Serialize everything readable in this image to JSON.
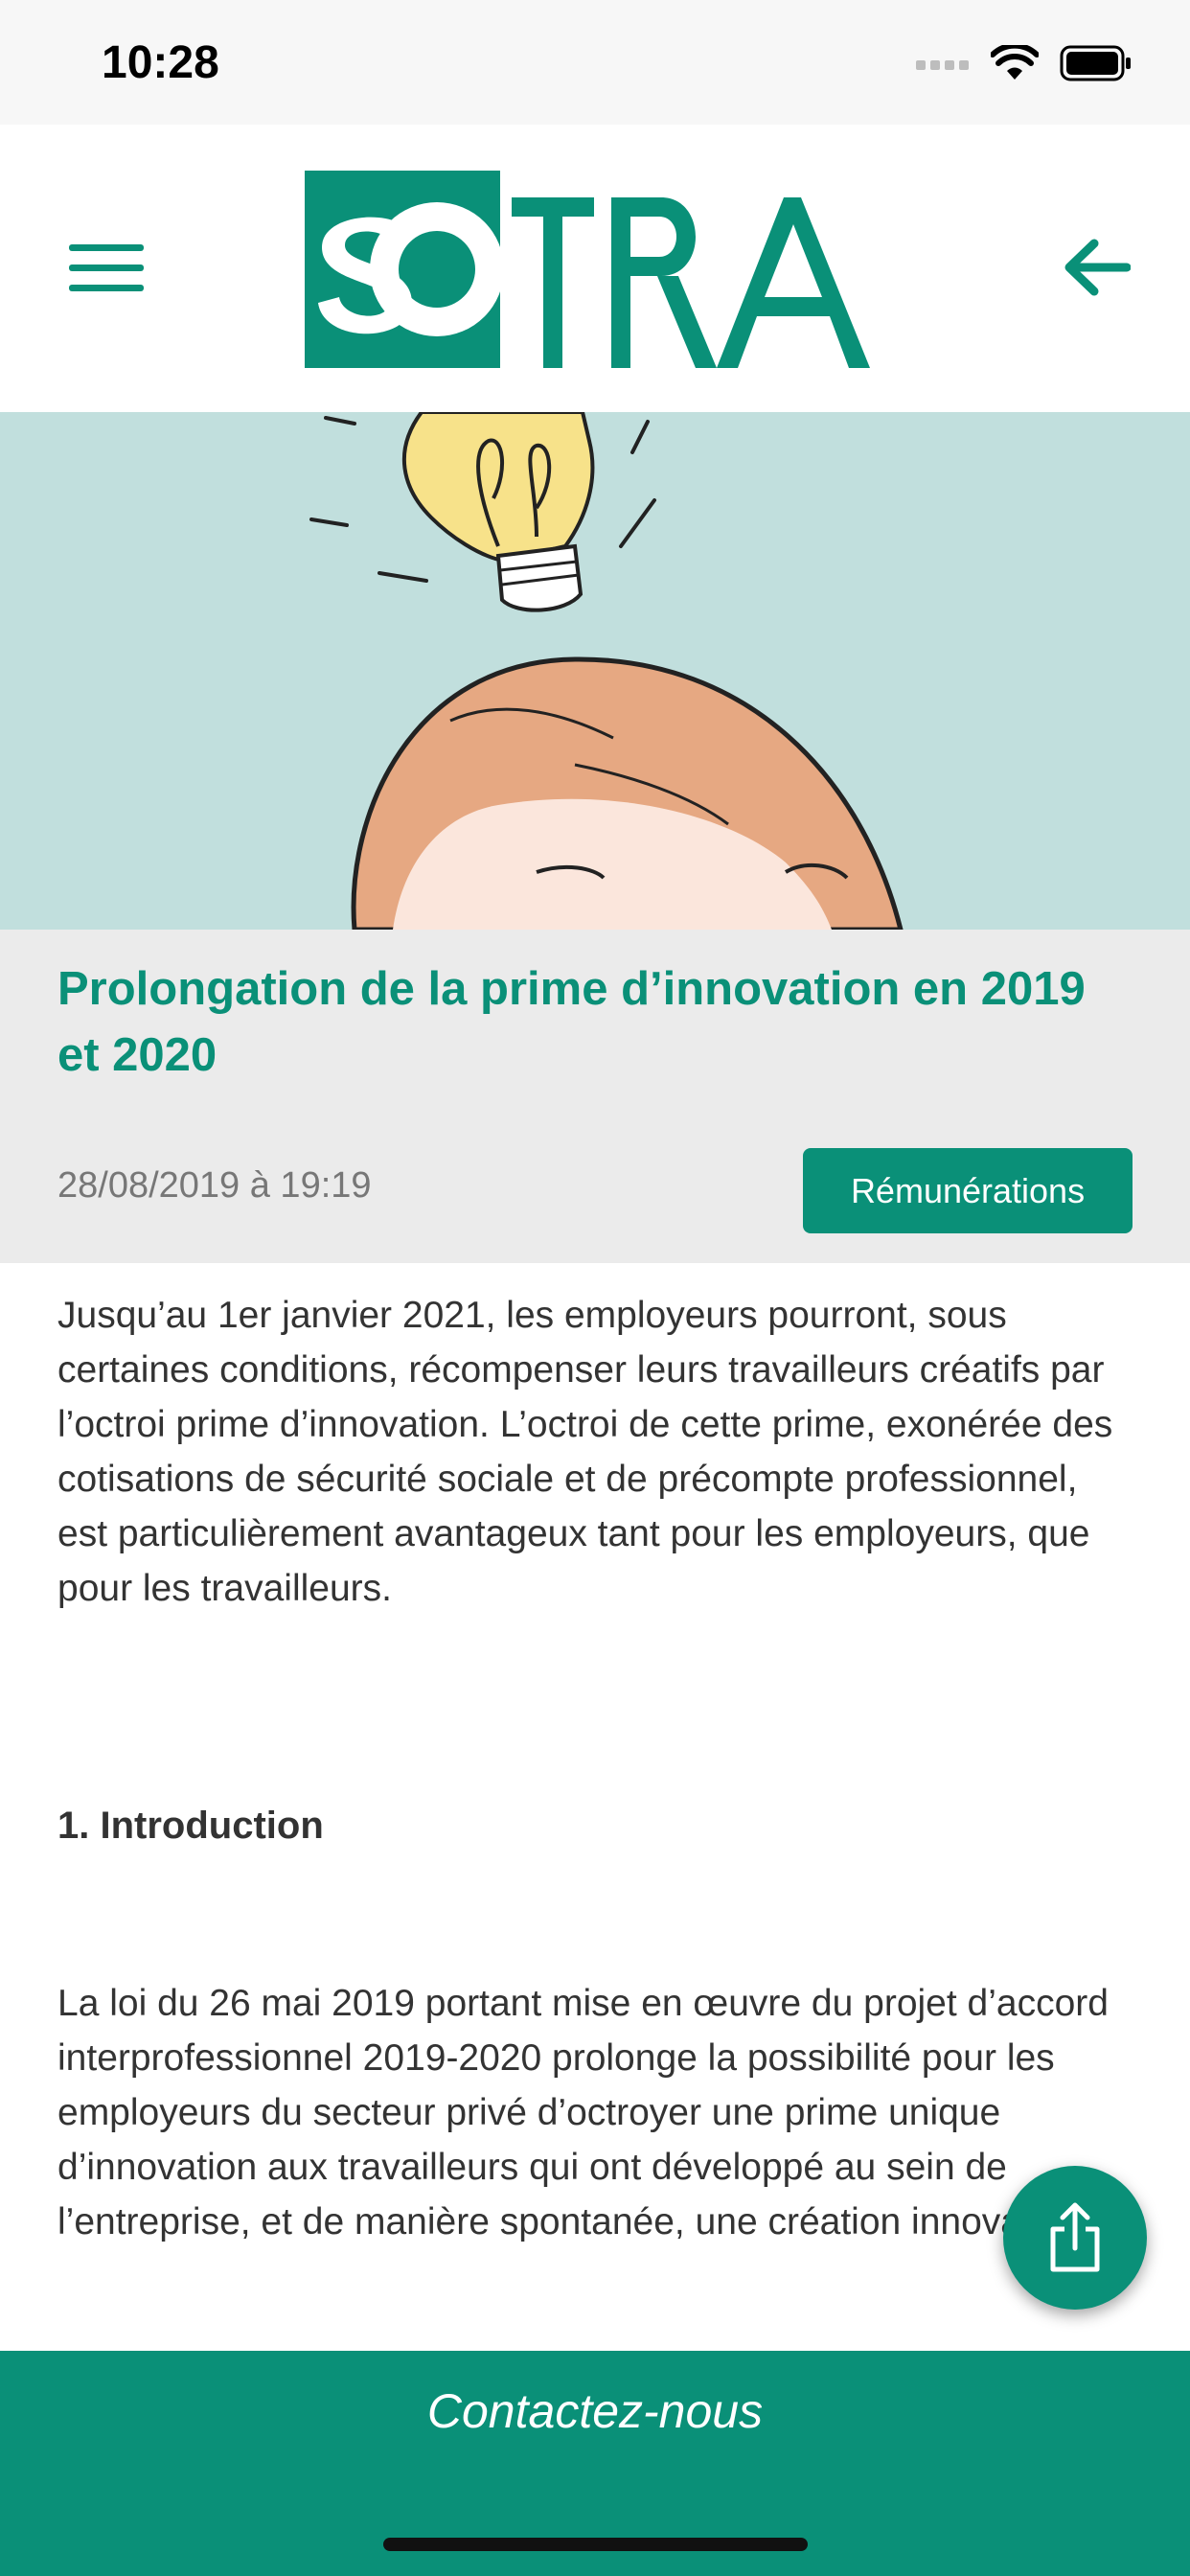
{
  "status_bar": {
    "time": "10:28"
  },
  "header": {
    "logo_text": "SOTRA"
  },
  "article": {
    "title": "Prolongation de la prime d’innovation en 2019 et 2020",
    "date": "28/08/2019 à 19:19",
    "category": "Rémunérations",
    "intro": "Jusqu’au 1er janvier 2021, les employeurs pourront, sous certaines conditions, récompenser leurs travailleurs créatifs par l’octroi prime d’innovation. L’octroi de cette prime, exonérée des cotisations de sécurité sociale et de précompte professionnel, est particulièrement avantageux tant pour les employeurs, que pour les travailleurs.",
    "section_heading": "1. Introduction",
    "section_text": "La loi du 26 mai 2019 portant mise en œuvre du projet d’accord interprofessionnel 2019-2020 prolonge la possibilité pour les employeurs du secteur privé d’octroyer une prime unique d’innovation aux travailleurs qui ont développé au sein de l’entreprise, et de manière spontanée, une création innovante."
  },
  "footer": {
    "contact_label": "Contactez-nous"
  },
  "colors": {
    "accent": "#0a9078",
    "hero_bg": "#c1dfdd",
    "panel_bg": "#ebebeb"
  }
}
